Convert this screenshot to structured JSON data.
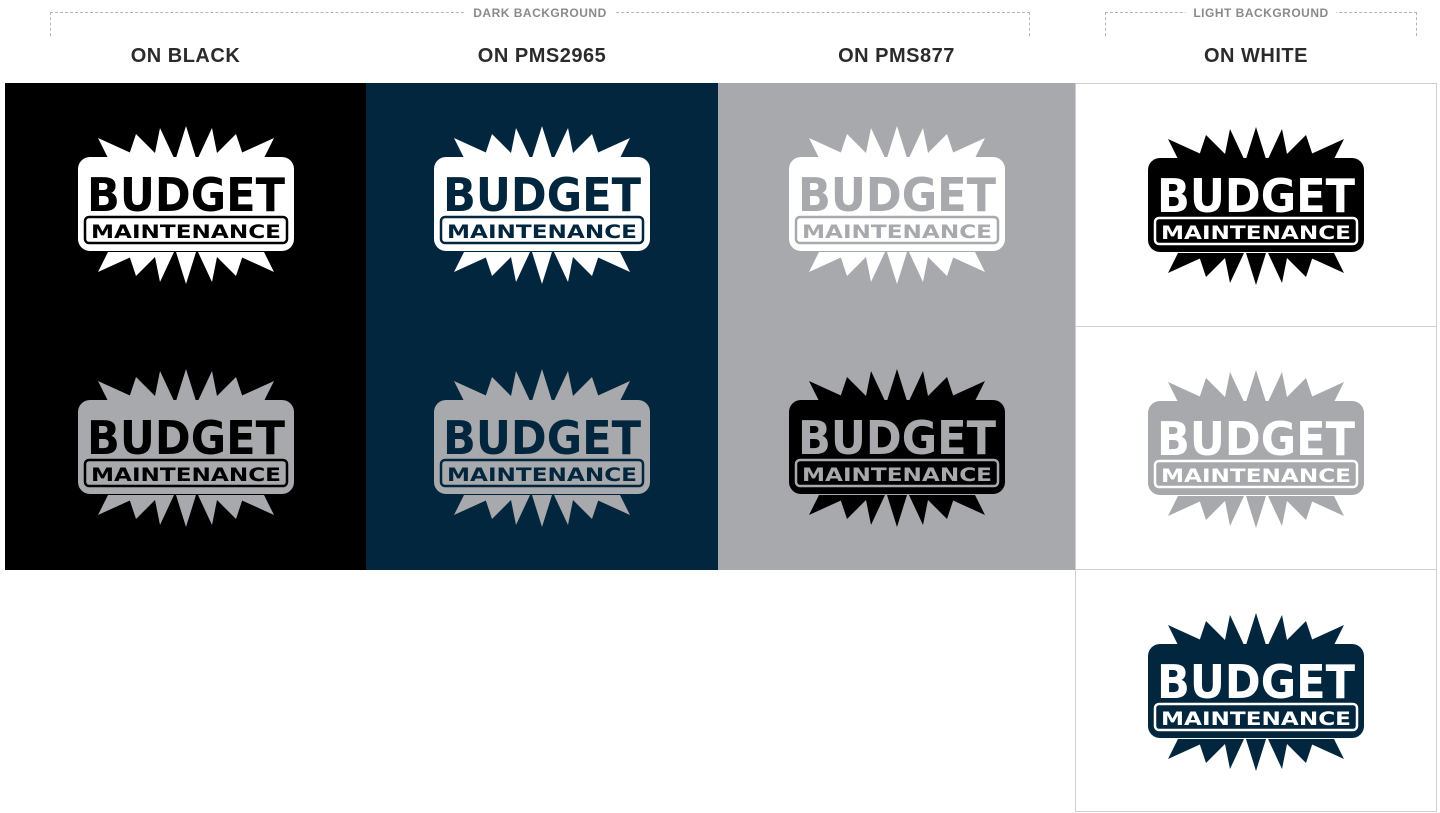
{
  "groups": {
    "dark": {
      "label": "DARK BACKGROUND"
    },
    "light": {
      "label": "LIGHT BACKGROUND"
    }
  },
  "columns": [
    {
      "heading": "ON BLACK",
      "background": "#000000"
    },
    {
      "heading": "ON PMS2965",
      "background": "#02263e"
    },
    {
      "heading": "ON PMS877",
      "background": "#a8a9ac"
    },
    {
      "heading": "ON WHITE",
      "background": "#ffffff"
    }
  ],
  "logo": {
    "line1": "BUDGET",
    "line2": "MAINTENANCE"
  },
  "variants": [
    {
      "column": 0,
      "row": 0,
      "fg": "#ffffff",
      "text": "#000000"
    },
    {
      "column": 0,
      "row": 1,
      "fg": "#a8a9ac",
      "text": "#000000"
    },
    {
      "column": 1,
      "row": 0,
      "fg": "#ffffff",
      "text": "#02263e"
    },
    {
      "column": 1,
      "row": 1,
      "fg": "#a8a9ac",
      "text": "#02263e"
    },
    {
      "column": 2,
      "row": 0,
      "fg": "#ffffff",
      "text": "#a8a9ac"
    },
    {
      "column": 2,
      "row": 1,
      "fg": "#000000",
      "text": "#a8a9ac"
    },
    {
      "column": 3,
      "row": 0,
      "fg": "#000000",
      "text": "#ffffff"
    },
    {
      "column": 3,
      "row": 1,
      "fg": "#a8a9ac",
      "text": "#ffffff"
    },
    {
      "column": 3,
      "row": 2,
      "fg": "#02263e",
      "text": "#ffffff"
    }
  ]
}
